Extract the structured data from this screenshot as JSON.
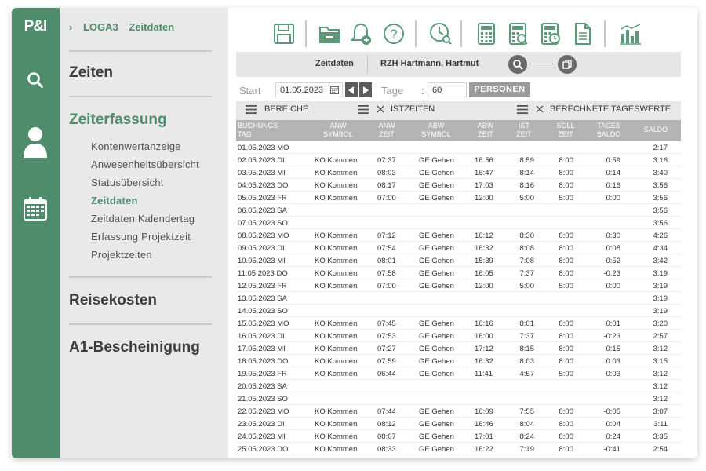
{
  "app": {
    "logo": "P&I"
  },
  "nav": {
    "breadcrumb": [
      "LOGA3",
      "Zeitdaten"
    ],
    "sections": {
      "zeiten": "Zeiten",
      "zeiterfassung": "Zeiterfassung",
      "reisekosten": "Reisekosten",
      "a1": "A1-Bescheinigung"
    },
    "sub_items": [
      "Kontenwertanzeige",
      "Anwesenheitsübersicht",
      "Statusübersicht",
      "Zeitdaten",
      "Zeitdaten Kalendertag",
      "Erfassung Projektzeit",
      "Projektzeiten"
    ]
  },
  "infobar": {
    "view": "Zeitdaten",
    "employee": "RZH Hartmann, Hartmut"
  },
  "filters": {
    "start_label": "Start",
    "start_value": "01.05.2023",
    "days_label": "Tage",
    "colon": ":",
    "days_value": "60",
    "persons_button": "PERSONEN"
  },
  "groups": {
    "bereiche": "BEREICHE",
    "istzeiten": "ISTZEITEN",
    "tageswerte": "BERECHNETE TAGESWERTE"
  },
  "columns": {
    "date": [
      "BUCHUNGS-",
      "TAG"
    ],
    "anw_symbol": [
      "ANW",
      "SYMBOL"
    ],
    "anw_zeit": [
      "ANW",
      "ZEIT"
    ],
    "abw_symbol": [
      "ABW",
      "SYMBOL"
    ],
    "abw_zeit": [
      "ABW",
      "ZEIT"
    ],
    "ist": [
      "IST",
      "ZEIT"
    ],
    "soll": [
      "SOLL",
      "ZEIT"
    ],
    "tagessaldo": [
      "TAGES",
      "SALDO"
    ],
    "saldo": [
      "SALDO"
    ]
  },
  "rows": [
    [
      "01.05.2023 MO",
      "",
      "",
      "",
      "",
      "",
      "",
      "",
      "2:17"
    ],
    [
      "02.05.2023 DI",
      "KO Kommen",
      "07:37",
      "GE Gehen",
      "16:56",
      "8:59",
      "8:00",
      "0:59",
      "3:16"
    ],
    [
      "03.05.2023 MI",
      "KO Kommen",
      "08:03",
      "GE Gehen",
      "16:47",
      "8:14",
      "8:00",
      "0:14",
      "3:40"
    ],
    [
      "04.05.2023 DO",
      "KO Kommen",
      "08:17",
      "GE Gehen",
      "17:03",
      "8:16",
      "8:00",
      "0:16",
      "3:56"
    ],
    [
      "05.05.2023 FR",
      "KO Kommen",
      "07:00",
      "GE Gehen",
      "12:00",
      "5:00",
      "5:00",
      "0:00",
      "3:56"
    ],
    [
      "06.05.2023 SA",
      "",
      "",
      "",
      "",
      "",
      "",
      "",
      "3:56"
    ],
    [
      "07.05.2023 SO",
      "",
      "",
      "",
      "",
      "",
      "",
      "",
      "3:56"
    ],
    [
      "08.05.2023 MO",
      "KO Kommen",
      "07:12",
      "GE Gehen",
      "16:12",
      "8:30",
      "8:00",
      "0:30",
      "4:26"
    ],
    [
      "09.05.2023 DI",
      "KO Kommen",
      "07:54",
      "GE Gehen",
      "16:32",
      "8:08",
      "8:00",
      "0:08",
      "4:34"
    ],
    [
      "10.05.2023 MI",
      "KO Kommen",
      "08:01",
      "GE Gehen",
      "15:39",
      "7:08",
      "8:00",
      "-0:52",
      "3:42"
    ],
    [
      "11.05.2023 DO",
      "KO Kommen",
      "07:58",
      "GE Gehen",
      "16:05",
      "7:37",
      "8:00",
      "-0:23",
      "3:19"
    ],
    [
      "12.05.2023 FR",
      "KO Kommen",
      "07:00",
      "GE Gehen",
      "12:00",
      "5:00",
      "5:00",
      "0:00",
      "3:19"
    ],
    [
      "13.05.2023 SA",
      "",
      "",
      "",
      "",
      "",
      "",
      "",
      "3:19"
    ],
    [
      "14.05.2023 SO",
      "",
      "",
      "",
      "",
      "",
      "",
      "",
      "3:19"
    ],
    [
      "15.05.2023 MO",
      "KO Kommen",
      "07:45",
      "GE Gehen",
      "16:16",
      "8:01",
      "8:00",
      "0:01",
      "3:20"
    ],
    [
      "16.05.2023 DI",
      "KO Kommen",
      "07:53",
      "GE Gehen",
      "16:00",
      "7:37",
      "8:00",
      "-0:23",
      "2:57"
    ],
    [
      "17.05.2023 MI",
      "KO Kommen",
      "07:27",
      "GE Gehen",
      "17:12",
      "8:15",
      "8:00",
      "0:15",
      "3:12"
    ],
    [
      "18.05.2023 DO",
      "KO Kommen",
      "07:59",
      "GE Gehen",
      "16:32",
      "8:03",
      "8:00",
      "0:03",
      "3:15"
    ],
    [
      "19.05.2023 FR",
      "KO Kommen",
      "06:44",
      "GE Gehen",
      "11:41",
      "4:57",
      "5:00",
      "-0:03",
      "3:12"
    ],
    [
      "20.05.2023 SA",
      "",
      "",
      "",
      "",
      "",
      "",
      "",
      "3:12"
    ],
    [
      "21.05.2023 SO",
      "",
      "",
      "",
      "",
      "",
      "",
      "",
      "3:12"
    ],
    [
      "22.05.2023 MO",
      "KO Kommen",
      "07:44",
      "GE Gehen",
      "16:09",
      "7:55",
      "8:00",
      "-0:05",
      "3:07"
    ],
    [
      "23.05.2023 DI",
      "KO Kommen",
      "08:12",
      "GE Gehen",
      "16:46",
      "8:04",
      "8:00",
      "0:04",
      "3:11"
    ],
    [
      "24.05.2023 MI",
      "KO Kommen",
      "08:07",
      "GE Gehen",
      "17:01",
      "8:24",
      "8:00",
      "0:24",
      "3:35"
    ],
    [
      "25.05.2023 DO",
      "KO Kommen",
      "08:33",
      "GE Gehen",
      "16:22",
      "7:19",
      "8:00",
      "-0:41",
      "2:54"
    ]
  ],
  "colors": {
    "brand": "#4e8c6c",
    "nav_bg": "#e9e9e9",
    "header_gray": "#b4b4b4"
  },
  "icons": {
    "rail": [
      "search-icon",
      "user-icon",
      "calendar-icon"
    ],
    "toolbar": [
      "save-icon",
      "folder-icon",
      "bell-plus-icon",
      "help-icon",
      "clock-search-icon",
      "calculator-icon",
      "calculator-search-icon",
      "calculator-clock-icon",
      "document-icon",
      "bar-chart-icon"
    ]
  }
}
